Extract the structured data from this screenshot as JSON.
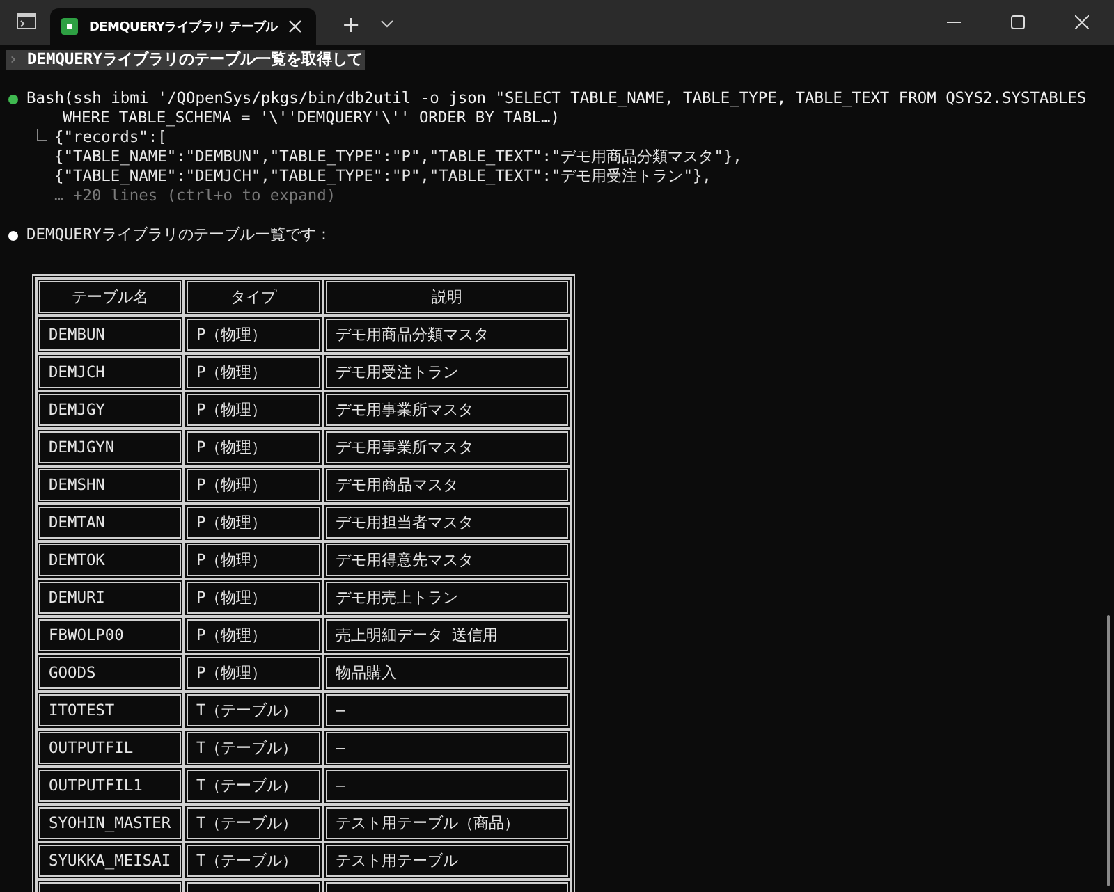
{
  "window": {
    "tab_title": "DEMQUERYライブラリ テーブル",
    "new_tab": "+"
  },
  "prompt": {
    "marker": "›",
    "text": "DEMQUERYライブラリのテーブル一覧を取得して"
  },
  "tool_call": {
    "color": "#3fb950",
    "command_lines": [
      "Bash(ssh ibmi '/QOpenSys/pkgs/bin/db2util -o json \"SELECT TABLE_NAME, TABLE_TYPE, TABLE_TEXT FROM QSYS2.SYSTABLES",
      "WHERE TABLE_SCHEMA = '\\''DEMQUERY'\\'' ORDER BY TABL…)"
    ],
    "output_lines": [
      "{\"records\":[",
      "{\"TABLE_NAME\":\"DEMBUN\",\"TABLE_TYPE\":\"P\",\"TABLE_TEXT\":\"デモ用商品分類マスタ\"},",
      "{\"TABLE_NAME\":\"DEMJCH\",\"TABLE_TYPE\":\"P\",\"TABLE_TEXT\":\"デモ用受注トラン\"},"
    ],
    "more": "… +20 lines (ctrl+o to expand)"
  },
  "message": {
    "color": "#ffffff",
    "text": "DEMQUERYライブラリのテーブル一覧です："
  },
  "table": {
    "columns": [
      "テーブル名",
      "タイプ",
      "説明"
    ],
    "rows": [
      [
        "DEMBUN",
        "P（物理）",
        "デモ用商品分類マスタ"
      ],
      [
        "DEMJCH",
        "P（物理）",
        "デモ用受注トラン"
      ],
      [
        "DEMJGY",
        "P（物理）",
        "デモ用事業所マスタ"
      ],
      [
        "DEMJGYN",
        "P（物理）",
        "デモ用事業所マスタ"
      ],
      [
        "DEMSHN",
        "P（物理）",
        "デモ用商品マスタ"
      ],
      [
        "DEMTAN",
        "P（物理）",
        "デモ用担当者マスタ"
      ],
      [
        "DEMTOK",
        "P（物理）",
        "デモ用得意先マスタ"
      ],
      [
        "DEMURI",
        "P（物理）",
        "デモ用売上トラン"
      ],
      [
        "FBWOLP00",
        "P（物理）",
        "売上明細データ 送信用"
      ],
      [
        "GOODS",
        "P（物理）",
        "物品購入"
      ],
      [
        "ITOTEST",
        "T（テーブル）",
        "–"
      ],
      [
        "OUTPUTFIL",
        "T（テーブル）",
        "–"
      ],
      [
        "OUTPUTFIL1",
        "T（テーブル）",
        "–"
      ],
      [
        "SYOHIN_MASTER",
        "T（テーブル）",
        "テスト用テーブル（商品）"
      ],
      [
        "SYUKKA_MEISAI",
        "T（テーブル）",
        "テスト用テーブル"
      ]
    ]
  }
}
